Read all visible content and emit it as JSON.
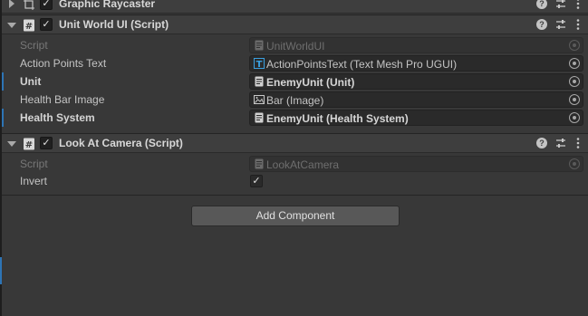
{
  "components": [
    {
      "title": "Graphic Raycaster",
      "expanded": false,
      "enabled": true,
      "icon": "raycaster-icon"
    },
    {
      "title": "Unit World UI (Script)",
      "expanded": true,
      "enabled": true,
      "icon": "script-icon",
      "fields": [
        {
          "label": "Script",
          "value": "UnitWorldUI",
          "icon": "script-file-icon",
          "disabled": true
        },
        {
          "label": "Action Points Text",
          "value": "ActionPointsText (Text Mesh Pro UGUI)",
          "icon": "textmeshpro-icon"
        },
        {
          "label": "Unit",
          "value": "EnemyUnit (Unit)",
          "icon": "script-file-icon",
          "overridden": true
        },
        {
          "label": "Health Bar Image",
          "value": "Bar (Image)",
          "icon": "image-icon"
        },
        {
          "label": "Health System",
          "value": "EnemyUnit (Health System)",
          "icon": "script-file-icon",
          "overridden": true
        }
      ]
    },
    {
      "title": "Look At Camera (Script)",
      "expanded": true,
      "enabled": true,
      "icon": "script-icon",
      "fields": [
        {
          "label": "Script",
          "value": "LookAtCamera",
          "icon": "script-file-icon",
          "disabled": true
        },
        {
          "label": "Invert",
          "checked": true
        }
      ]
    }
  ],
  "add_component_label": "Add Component",
  "colors": {
    "background": "#383838",
    "header": "#3e3e3e",
    "field": "#2a2a2a",
    "override_accent": "#2d74b5",
    "button": "#585858"
  }
}
